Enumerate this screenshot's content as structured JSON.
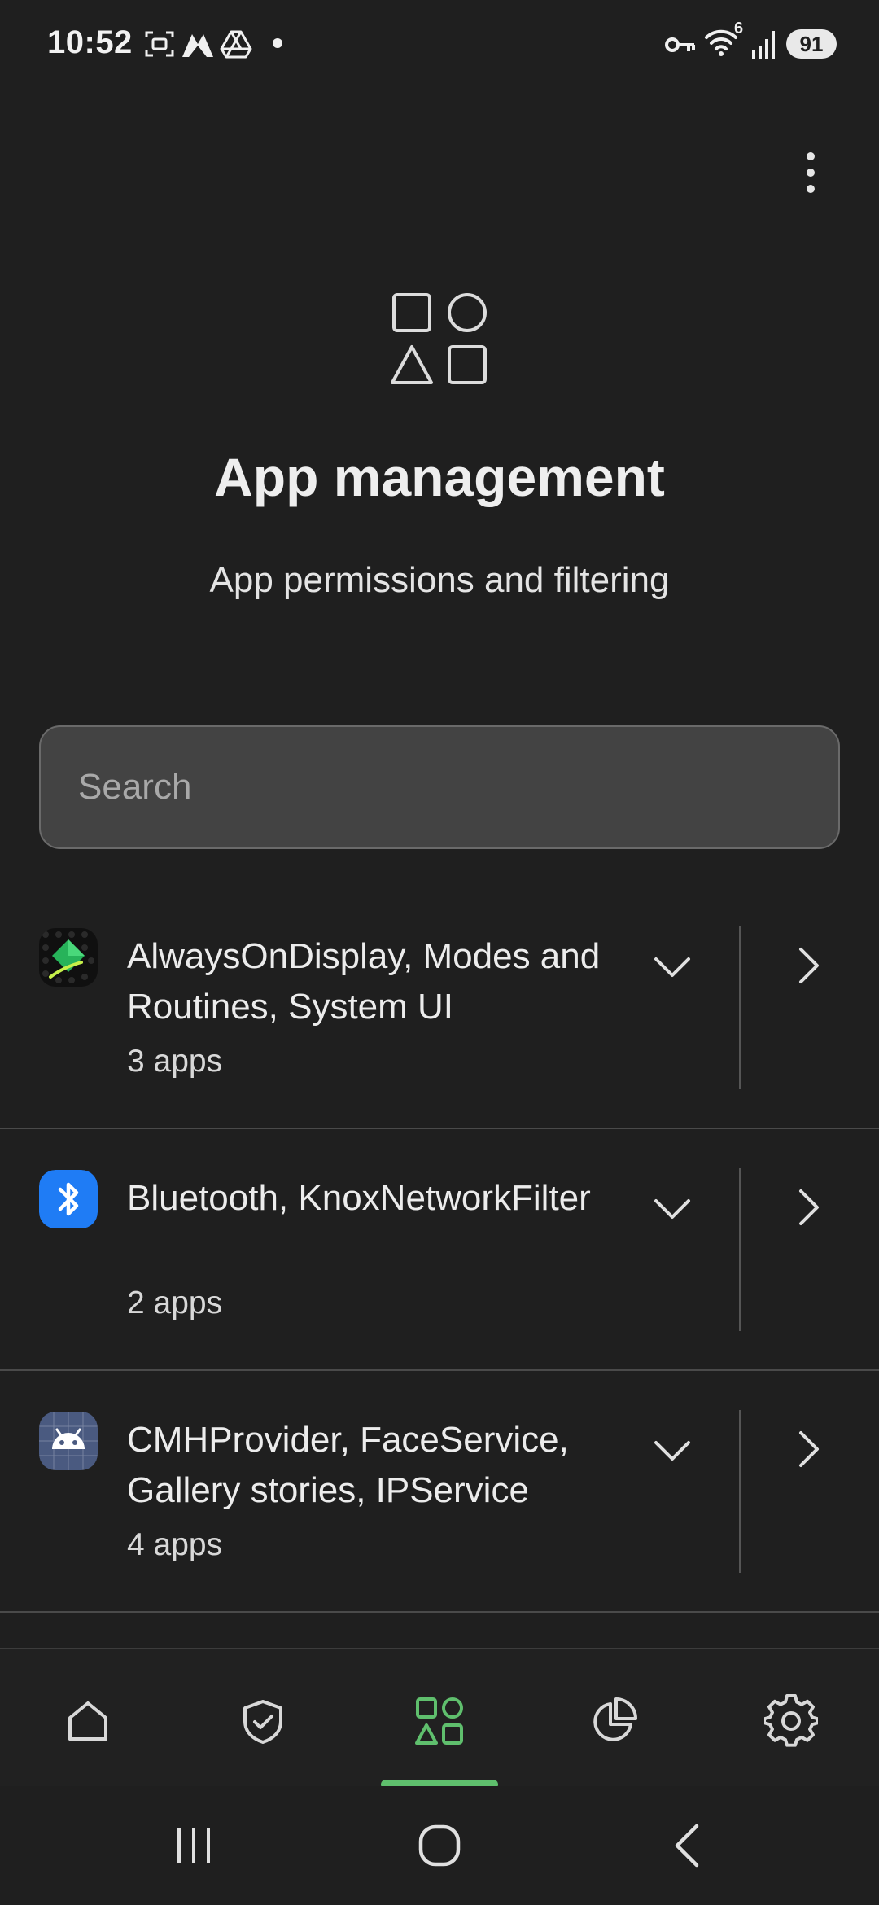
{
  "status_bar": {
    "time": "10:52",
    "battery_level": "91",
    "network_label": "6",
    "icons": [
      "screenshot-icon",
      "app-notification-icon",
      "drive-icon",
      "dot-icon",
      "vpn-key-icon",
      "wifi-icon",
      "signal-icon",
      "battery-icon"
    ]
  },
  "header": {
    "menu_icon": "more-vertical-icon",
    "hero_icon": "shapes-icon",
    "title": "App management",
    "subtitle": "App permissions and filtering"
  },
  "search": {
    "placeholder": "Search",
    "value": ""
  },
  "app_groups": [
    {
      "name": "AlwaysOnDisplay, Modes and Routines, System UI",
      "count": "3 apps",
      "icon": "system-app-icon"
    },
    {
      "name": "Bluetooth, KnoxNetworkFilter",
      "count": "2 apps",
      "icon": "bluetooth-icon"
    },
    {
      "name": "CMHProvider, FaceService, Gallery stories, IPService",
      "count": "4 apps",
      "icon": "android-icon"
    }
  ],
  "bottom_nav": {
    "items": [
      {
        "id": "home",
        "icon": "home-icon"
      },
      {
        "id": "protection",
        "icon": "shield-check-icon"
      },
      {
        "id": "apps",
        "icon": "apps-icon",
        "active": true
      },
      {
        "id": "statistics",
        "icon": "pie-chart-icon"
      },
      {
        "id": "settings",
        "icon": "gear-icon"
      }
    ]
  },
  "colors": {
    "background": "#1f1f1f",
    "accent": "#5fbf6d",
    "search_background": "#434343",
    "bluetooth_blue": "#1f7cf5",
    "android_slate": "#4a5a80"
  }
}
